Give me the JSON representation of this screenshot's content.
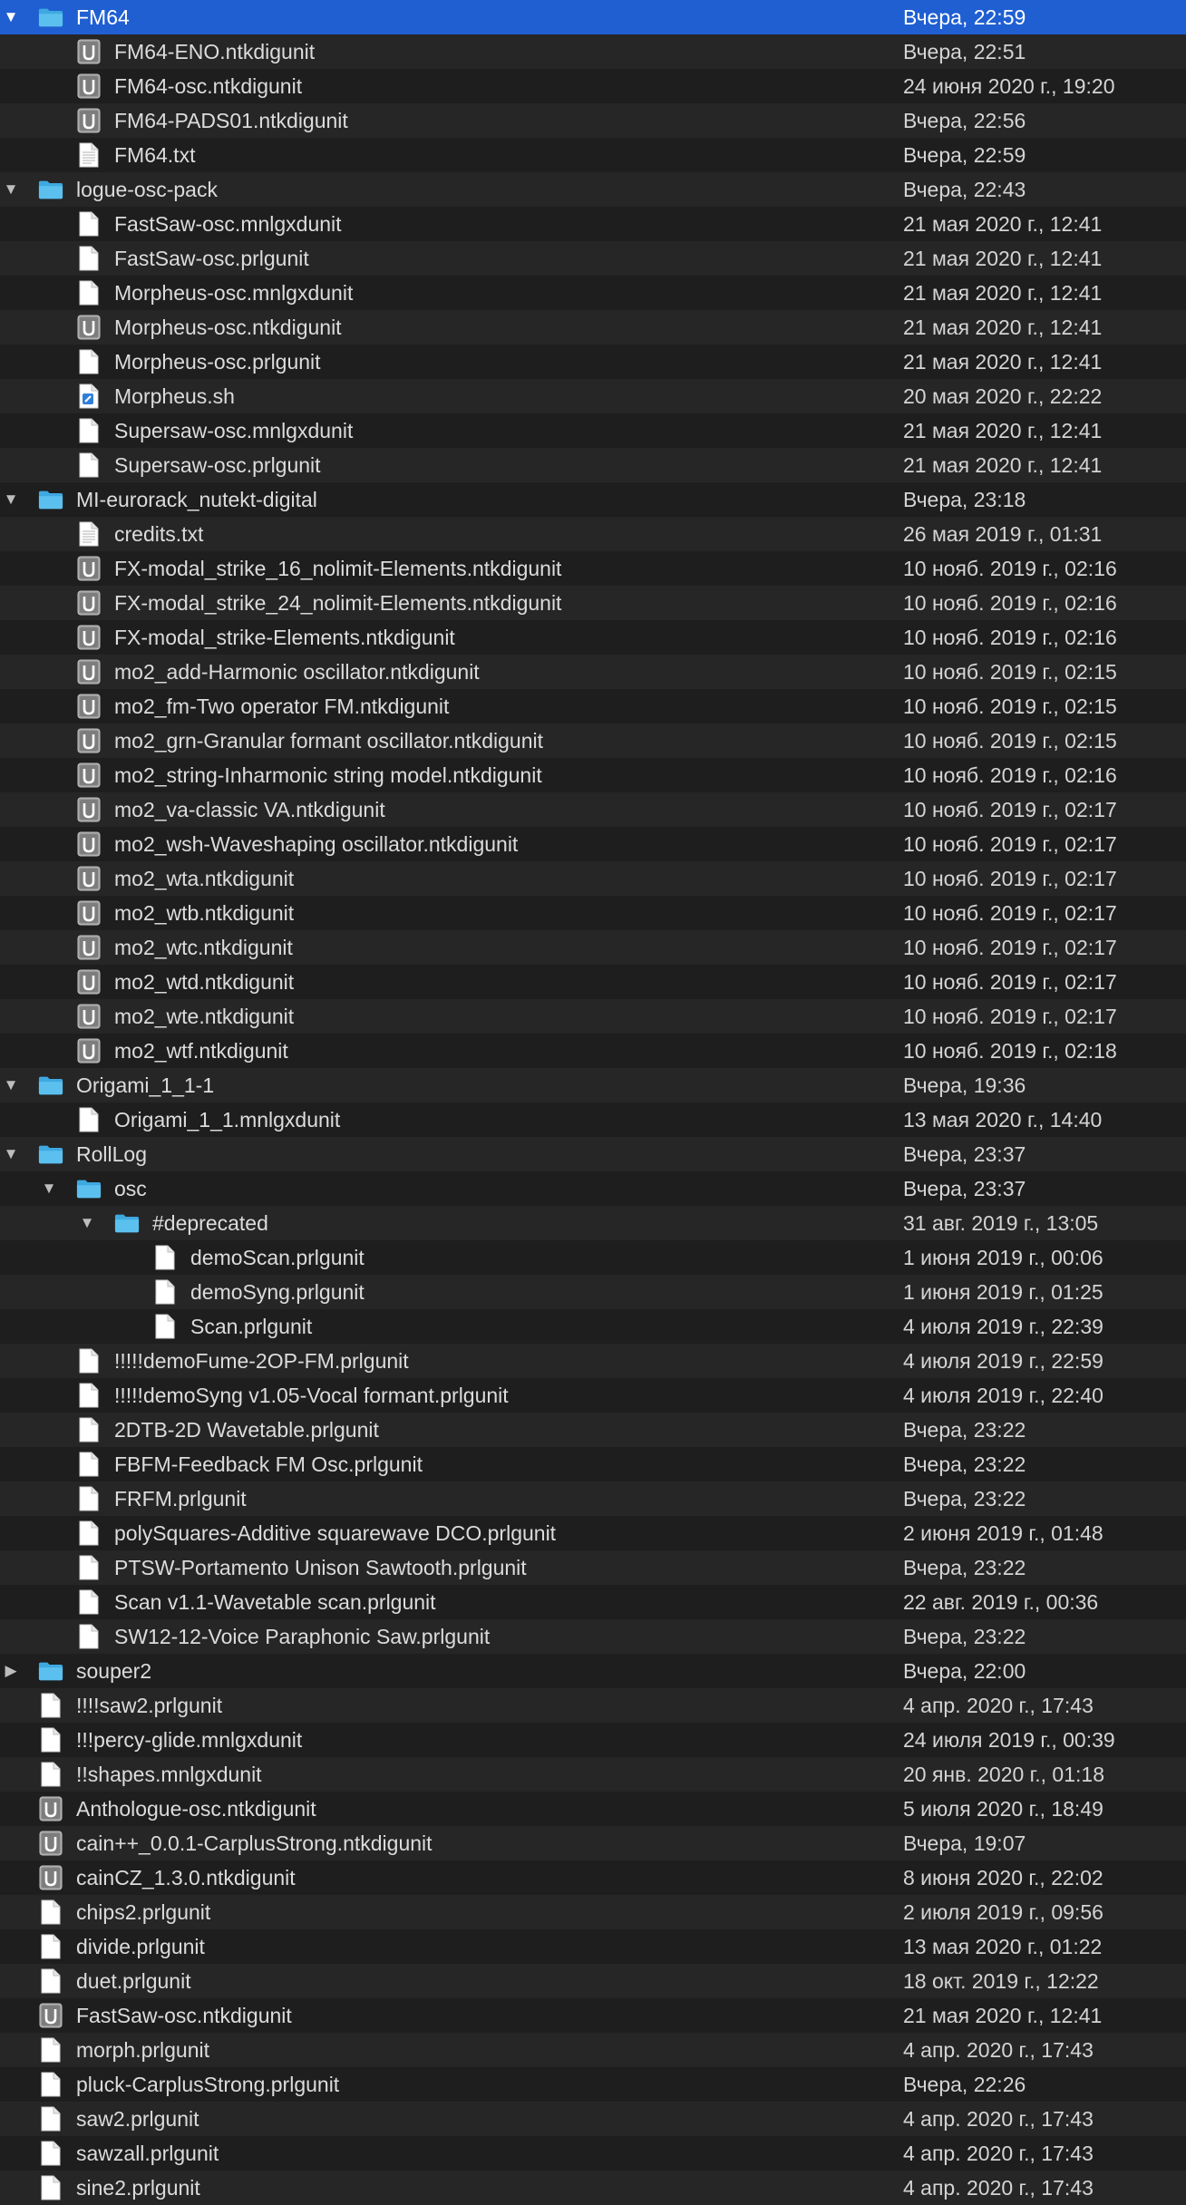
{
  "rows": [
    {
      "name": "FM64",
      "date": "Вчера, 22:59",
      "level": 0,
      "type": "folder",
      "open": true,
      "selected": true
    },
    {
      "name": "FM64-ENO.ntkdigunit",
      "date": "Вчера, 22:51",
      "level": 1,
      "type": "unit"
    },
    {
      "name": "FM64-osc.ntkdigunit",
      "date": "24 июня 2020 г., 19:20",
      "level": 1,
      "type": "unit"
    },
    {
      "name": "FM64-PADS01.ntkdigunit",
      "date": "Вчера, 22:56",
      "level": 1,
      "type": "unit"
    },
    {
      "name": "FM64.txt",
      "date": "Вчера, 22:59",
      "level": 1,
      "type": "text"
    },
    {
      "name": "logue-osc-pack",
      "date": "Вчера, 22:43",
      "level": 0,
      "type": "folder",
      "open": true
    },
    {
      "name": "FastSaw-osc.mnlgxdunit",
      "date": "21 мая 2020 г., 12:41",
      "level": 1,
      "type": "file"
    },
    {
      "name": "FastSaw-osc.prlgunit",
      "date": "21 мая 2020 г., 12:41",
      "level": 1,
      "type": "file"
    },
    {
      "name": "Morpheus-osc.mnlgxdunit",
      "date": "21 мая 2020 г., 12:41",
      "level": 1,
      "type": "file"
    },
    {
      "name": "Morpheus-osc.ntkdigunit",
      "date": "21 мая 2020 г., 12:41",
      "level": 1,
      "type": "unit"
    },
    {
      "name": "Morpheus-osc.prlgunit",
      "date": "21 мая 2020 г., 12:41",
      "level": 1,
      "type": "file"
    },
    {
      "name": "Morpheus.sh",
      "date": "20 мая 2020 г., 22:22",
      "level": 1,
      "type": "script"
    },
    {
      "name": "Supersaw-osc.mnlgxdunit",
      "date": "21 мая 2020 г., 12:41",
      "level": 1,
      "type": "file"
    },
    {
      "name": "Supersaw-osc.prlgunit",
      "date": "21 мая 2020 г., 12:41",
      "level": 1,
      "type": "file"
    },
    {
      "name": "MI-eurorack_nutekt-digital",
      "date": "Вчера, 23:18",
      "level": 0,
      "type": "folder",
      "open": true
    },
    {
      "name": "credits.txt",
      "date": "26 мая 2019 г., 01:31",
      "level": 1,
      "type": "text"
    },
    {
      "name": "FX-modal_strike_16_nolimit-Elements.ntkdigunit",
      "date": "10 нояб. 2019 г., 02:16",
      "level": 1,
      "type": "unit"
    },
    {
      "name": "FX-modal_strike_24_nolimit-Elements.ntkdigunit",
      "date": "10 нояб. 2019 г., 02:16",
      "level": 1,
      "type": "unit"
    },
    {
      "name": "FX-modal_strike-Elements.ntkdigunit",
      "date": "10 нояб. 2019 г., 02:16",
      "level": 1,
      "type": "unit"
    },
    {
      "name": "mo2_add-Harmonic oscillator.ntkdigunit",
      "date": "10 нояб. 2019 г., 02:15",
      "level": 1,
      "type": "unit"
    },
    {
      "name": "mo2_fm-Two operator FM.ntkdigunit",
      "date": "10 нояб. 2019 г., 02:15",
      "level": 1,
      "type": "unit"
    },
    {
      "name": "mo2_grn-Granular formant oscillator.ntkdigunit",
      "date": "10 нояб. 2019 г., 02:15",
      "level": 1,
      "type": "unit"
    },
    {
      "name": "mo2_string-Inharmonic string model.ntkdigunit",
      "date": "10 нояб. 2019 г., 02:16",
      "level": 1,
      "type": "unit"
    },
    {
      "name": "mo2_va-classic VA.ntkdigunit",
      "date": "10 нояб. 2019 г., 02:17",
      "level": 1,
      "type": "unit"
    },
    {
      "name": "mo2_wsh-Waveshaping oscillator.ntkdigunit",
      "date": "10 нояб. 2019 г., 02:17",
      "level": 1,
      "type": "unit"
    },
    {
      "name": "mo2_wta.ntkdigunit",
      "date": "10 нояб. 2019 г., 02:17",
      "level": 1,
      "type": "unit"
    },
    {
      "name": "mo2_wtb.ntkdigunit",
      "date": "10 нояб. 2019 г., 02:17",
      "level": 1,
      "type": "unit"
    },
    {
      "name": "mo2_wtc.ntkdigunit",
      "date": "10 нояб. 2019 г., 02:17",
      "level": 1,
      "type": "unit"
    },
    {
      "name": "mo2_wtd.ntkdigunit",
      "date": "10 нояб. 2019 г., 02:17",
      "level": 1,
      "type": "unit"
    },
    {
      "name": "mo2_wte.ntkdigunit",
      "date": "10 нояб. 2019 г., 02:17",
      "level": 1,
      "type": "unit"
    },
    {
      "name": "mo2_wtf.ntkdigunit",
      "date": "10 нояб. 2019 г., 02:18",
      "level": 1,
      "type": "unit"
    },
    {
      "name": "Origami_1_1-1",
      "date": "Вчера, 19:36",
      "level": 0,
      "type": "folder",
      "open": true
    },
    {
      "name": "Origami_1_1.mnlgxdunit",
      "date": "13 мая 2020 г., 14:40",
      "level": 1,
      "type": "file"
    },
    {
      "name": "RollLog",
      "date": "Вчера, 23:37",
      "level": 0,
      "type": "folder",
      "open": true
    },
    {
      "name": "osc",
      "date": "Вчера, 23:37",
      "level": 1,
      "type": "folder",
      "open": true
    },
    {
      "name": "#deprecated",
      "date": "31 авг. 2019 г., 13:05",
      "level": 2,
      "type": "folder",
      "open": true
    },
    {
      "name": "demoScan.prlgunit",
      "date": "1 июня 2019 г., 00:06",
      "level": 3,
      "type": "file"
    },
    {
      "name": "demoSyng.prlgunit",
      "date": "1 июня 2019 г., 01:25",
      "level": 3,
      "type": "file"
    },
    {
      "name": "Scan.prlgunit",
      "date": "4 июля 2019 г., 22:39",
      "level": 3,
      "type": "file"
    },
    {
      "name": "!!!!!demoFume-2OP-FM.prlgunit",
      "date": "4 июля 2019 г., 22:59",
      "level": 1,
      "type": "file"
    },
    {
      "name": "!!!!!demoSyng v1.05-Vocal formant.prlgunit",
      "date": "4 июля 2019 г., 22:40",
      "level": 1,
      "type": "file"
    },
    {
      "name": "2DTB-2D Wavetable.prlgunit",
      "date": "Вчера, 23:22",
      "level": 1,
      "type": "file"
    },
    {
      "name": "FBFM-Feedback FM Osc.prlgunit",
      "date": "Вчера, 23:22",
      "level": 1,
      "type": "file"
    },
    {
      "name": "FRFM.prlgunit",
      "date": "Вчера, 23:22",
      "level": 1,
      "type": "file"
    },
    {
      "name": "polySquares-Additive squarewave DCO.prlgunit",
      "date": "2 июня 2019 г., 01:48",
      "level": 1,
      "type": "file"
    },
    {
      "name": "PTSW-Portamento Unison Sawtooth.prlgunit",
      "date": "Вчера, 23:22",
      "level": 1,
      "type": "file"
    },
    {
      "name": "Scan v1.1-Wavetable scan.prlgunit",
      "date": "22 авг. 2019 г., 00:36",
      "level": 1,
      "type": "file"
    },
    {
      "name": "SW12-12-Voice Paraphonic Saw.prlgunit",
      "date": "Вчера, 23:22",
      "level": 1,
      "type": "file"
    },
    {
      "name": "souper2",
      "date": "Вчера, 22:00",
      "level": 0,
      "type": "folder",
      "open": false
    },
    {
      "name": "!!!!saw2.prlgunit",
      "date": "4 апр. 2020 г., 17:43",
      "level": 0,
      "type": "file"
    },
    {
      "name": "!!!percy-glide.mnlgxdunit",
      "date": "24 июля 2019 г., 00:39",
      "level": 0,
      "type": "file"
    },
    {
      "name": "!!shapes.mnlgxdunit",
      "date": "20 янв. 2020 г., 01:18",
      "level": 0,
      "type": "file"
    },
    {
      "name": "Anthologue-osc.ntkdigunit",
      "date": "5 июля 2020 г., 18:49",
      "level": 0,
      "type": "unit"
    },
    {
      "name": "cain++_0.0.1-CarplusStrong.ntkdigunit",
      "date": "Вчера, 19:07",
      "level": 0,
      "type": "unit"
    },
    {
      "name": "cainCZ_1.3.0.ntkdigunit",
      "date": "8 июня 2020 г., 22:02",
      "level": 0,
      "type": "unit"
    },
    {
      "name": "chips2.prlgunit",
      "date": "2 июля 2019 г., 09:56",
      "level": 0,
      "type": "file"
    },
    {
      "name": "divide.prlgunit",
      "date": "13 мая 2020 г., 01:22",
      "level": 0,
      "type": "file"
    },
    {
      "name": "duet.prlgunit",
      "date": "18 окт. 2019 г., 12:22",
      "level": 0,
      "type": "file"
    },
    {
      "name": "FastSaw-osc.ntkdigunit",
      "date": "21 мая 2020 г., 12:41",
      "level": 0,
      "type": "unit"
    },
    {
      "name": "morph.prlgunit",
      "date": "4 апр. 2020 г., 17:43",
      "level": 0,
      "type": "file"
    },
    {
      "name": "pluck-CarplusStrong.prlgunit",
      "date": "Вчера, 22:26",
      "level": 0,
      "type": "file"
    },
    {
      "name": "saw2.prlgunit",
      "date": "4 апр. 2020 г., 17:43",
      "level": 0,
      "type": "file"
    },
    {
      "name": "sawzall.prlgunit",
      "date": "4 апр. 2020 г., 17:43",
      "level": 0,
      "type": "file"
    },
    {
      "name": "sine2.prlgunit",
      "date": "4 апр. 2020 г., 17:43",
      "level": 0,
      "type": "file"
    }
  ],
  "colors": {
    "background": "#1e1e1e",
    "row_alt": "#262626",
    "selection": "#1f5fd2",
    "folder": "#4fb6e8",
    "text": "#dcdcdc",
    "date_text": "#d4d4d4"
  }
}
